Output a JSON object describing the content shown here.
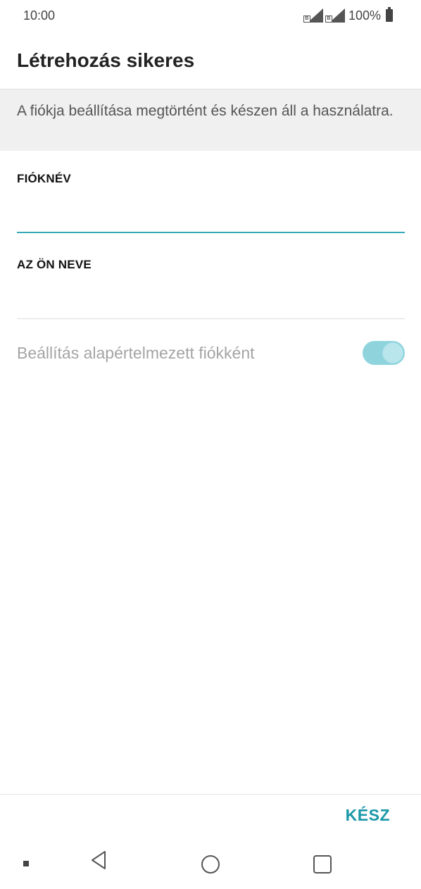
{
  "status_bar": {
    "time": "10:00",
    "sim1_label": "B",
    "sim2_label": "B",
    "battery_percent": "100%",
    "icons": [
      "signal-sim1-icon",
      "signal-sim2-icon",
      "battery-icon"
    ]
  },
  "header": {
    "title": "Létrehozás sikeres"
  },
  "info_banner": {
    "text": "A fiókja beállítása megtörtént és készen áll a használatra."
  },
  "form": {
    "account_name": {
      "label": "FIÓKNÉV",
      "value": "",
      "placeholder": ""
    },
    "your_name": {
      "label": "AZ ÖN NEVE",
      "value": "",
      "placeholder": ""
    },
    "default_account": {
      "label": "Beállítás alapértelmezett fiókként",
      "enabled": true
    }
  },
  "footer": {
    "done_label": "KÉSZ"
  },
  "navigation": {
    "icons": [
      "menu-dot-icon",
      "back-icon",
      "home-icon",
      "recent-apps-icon"
    ]
  },
  "colors": {
    "accent": "#1a98a8",
    "active_underline": "#35a9b7",
    "toggle_track": "#8fd4dd",
    "banner_bg": "#f0f0f0"
  }
}
